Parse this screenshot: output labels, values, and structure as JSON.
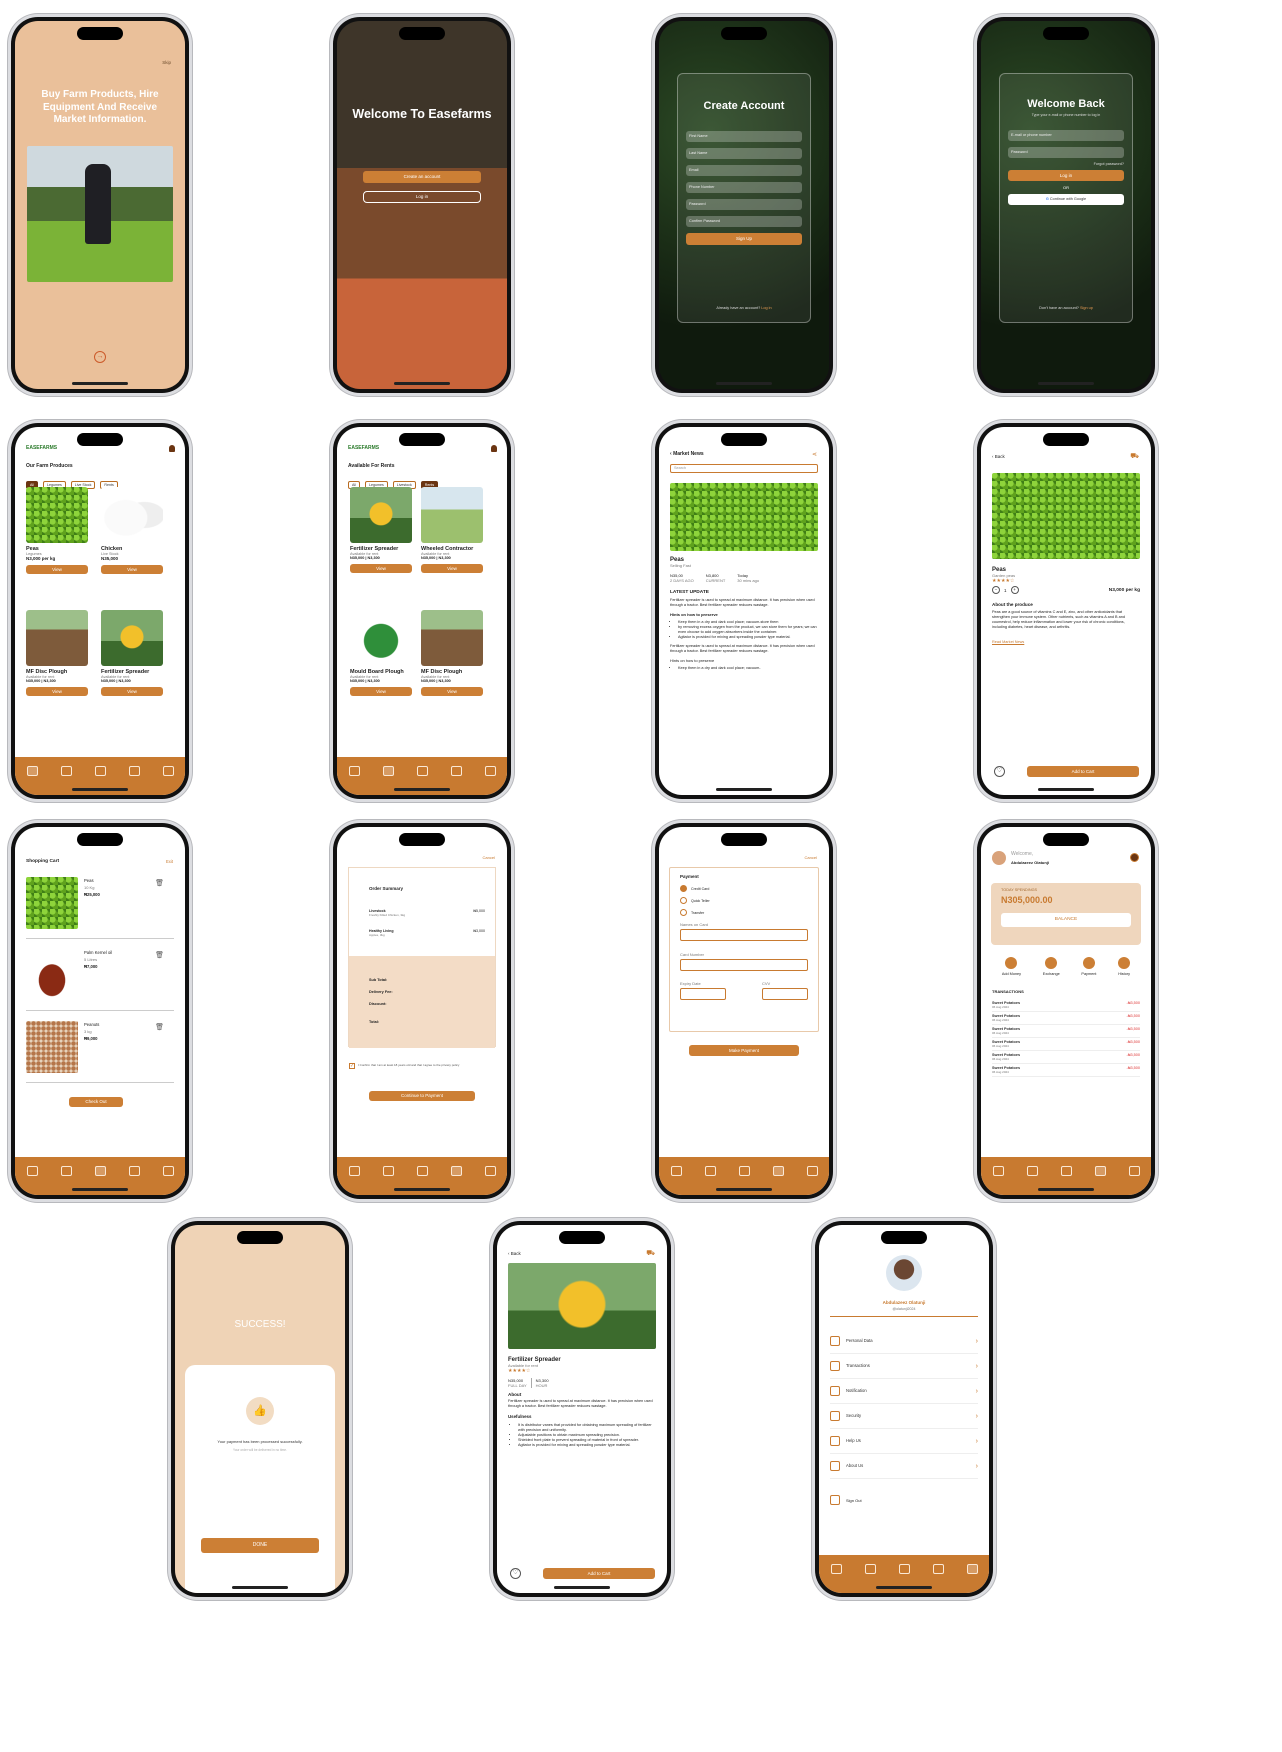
{
  "onboarding": {
    "skip": "Skip",
    "headline": "Buy Farm Products, Hire Equipment And Receive Market Information."
  },
  "welcome": {
    "title": "Welcome To Easefarms",
    "create": "Create an account",
    "login": "Log in"
  },
  "create_account": {
    "title": "Create Account",
    "fields": [
      "First Name",
      "Last Name",
      "Email",
      "Phone Number",
      "Password",
      "Confirm Password"
    ],
    "signup": "Sign Up",
    "footer": "Already have an account?",
    "footer_link": "Log in"
  },
  "welcome_back": {
    "title": "Welcome Back",
    "subtitle": "Type your e-mail or phone number to log in",
    "email": "E-mail or phone number",
    "password": "Password",
    "forgot": "Forgot password?",
    "login": "Log in",
    "or": "OR",
    "google": "Continue with Google",
    "footer": "Don't have an account?",
    "footer_link": "Sign up"
  },
  "farm_produces": {
    "logo": "EASEFARMS",
    "title": "Our Farm Produces",
    "filters": [
      "All",
      "Legumes",
      "Live Stock",
      "Rents"
    ],
    "items": [
      {
        "name": "Peas",
        "category": "Legumes",
        "price": "N3,000 per kg"
      },
      {
        "name": "Chicken",
        "category": "Live Stock",
        "price": "N35,000"
      }
    ],
    "rents": [
      {
        "name": "MF Disc Plough",
        "status": "Available for rent",
        "day": "N35,000",
        "day_lbl": "FULL DAY",
        "hour": "N3,300",
        "hour_lbl": "HOUR"
      },
      {
        "name": "Fertilizer Spreader",
        "status": "Available for rent",
        "day": "N35,000",
        "day_lbl": "FULL DAY",
        "hour": "N3,300",
        "hour_lbl": "HOUR"
      }
    ],
    "view": "View"
  },
  "rents": {
    "logo": "EASEFARMS",
    "title": "Available For Rents",
    "filters": [
      "All",
      "Legumes",
      "Livestock",
      "Rents"
    ],
    "items": [
      {
        "name": "Fertilizer Spreader",
        "status": "Available for rent",
        "day": "N35,000",
        "hour": "N3,300"
      },
      {
        "name": "Wheeled Contractor",
        "status": "Available for rent",
        "day": "N35,000",
        "hour": "N3,300"
      },
      {
        "name": "Mould Board Plough",
        "status": "Available for rent",
        "day": "N35,000",
        "hour": "N3,300"
      },
      {
        "name": "MF Disc Plough",
        "status": "Available for rent",
        "day": "N35,000",
        "hour": "N3,300"
      }
    ],
    "day_lbl": "FULL DAY",
    "hour_lbl": "HOUR",
    "view": "View"
  },
  "market_news": {
    "title": "Market News",
    "search": "Search",
    "product": "Peas",
    "selling": "Selling Fast",
    "p1": "N35,00",
    "p1_lbl": "2 DAYS AGO",
    "p2": "N3,800",
    "p2_lbl": "CURRENT",
    "p3": "Today",
    "p3_lbl": "30 mins ago",
    "latest": "LATEST UPDATE",
    "para": "Fertilizer spreader is used to spread at maximum distance. It has precision when used through a tractor. Best fertilizer spreader reduces wastage.",
    "hints": "Hints on how to preserve",
    "bullets": [
      "Keep them in a dry and dark cool place; vacuum-store them",
      "by removing excess oxygen from the product, we can store them for years; we can even choose to add oxygen absorbers inside the container.",
      "Agitator is provided for mixing and spreading powder type material."
    ],
    "para2": "Fertilizer spreader is used to spread at maximum distance. It has precision when used through a tractor. Best fertilizer spreader reduces wastage.",
    "hints2": "Hints on how to preserve",
    "bullet_last": "Keep them in a dry and dark cool place; vacuum-"
  },
  "product": {
    "back": "Back",
    "name": "Peas",
    "sub": "Garden peas",
    "qty": "1",
    "price": "N3,000 per kg",
    "about": "About the produce",
    "desc": "Peas are a good source of vitamins C and E, zinc, and other antioxidants that strengthen your immune system. Other nutrients, such as vitamins A and B and coumestrol, help reduce inflammation and lower your risk of chronic conditions, including diabetes, heart disease, and arthritis.",
    "link": "Read Market News",
    "cart": "Add to Cart"
  },
  "cart": {
    "title": "Shopping Cart",
    "exit": "Exit",
    "items": [
      {
        "name": "Peas",
        "qty": "10 Kg",
        "price": "₦25,000"
      },
      {
        "name": "Palm Kernel oil",
        "qty": "5 Litres",
        "price": "₦7,000"
      },
      {
        "name": "Peanuts",
        "qty": "3 kg",
        "price": "₦9,000"
      }
    ],
    "checkout": "Check Out"
  },
  "order": {
    "cancel": "Cancel",
    "title": "Order Summary",
    "l1": "Livestock",
    "l1s": "Freshly Killed Chicken, 3kg",
    "l1p": "₦5,000",
    "l2": "Healthy Living",
    "l2s": "Apples, 3kg",
    "l2p": "₦3,000",
    "subtotal": "Sub Total:",
    "delivery": "Delivery Fee:",
    "discount": "Discount:",
    "total": "Total:",
    "agree": "I Confirm that I am at least 18 years old and that I agree to the privacy policy",
    "cont": "Continue to Payment"
  },
  "payment": {
    "cancel": "Cancel",
    "title": "Payment",
    "options": [
      "Credit Card",
      "Quick Teller",
      "Transfer"
    ],
    "name": "Names on Card",
    "number": "Card Number",
    "expiry": "Expiry Date",
    "cvv": "CVV",
    "make": "Make Payment"
  },
  "wallet": {
    "welcome": "Welcome,",
    "user": "Abdulazeez Olatunji",
    "spend_lbl": "TODAY SPENDINGS",
    "spend": "N305,000.00",
    "balance": "BALANCE",
    "actions": [
      "Add Money",
      "Exchange",
      "Payment",
      "History"
    ],
    "tx_title": "TRANSACTIONS",
    "tx_name": "Sweet Potatoes",
    "tx_date": "06 Aug 2024",
    "tx_amt": "-₦3,500"
  },
  "success": {
    "title": "SUCCESS!",
    "msg": "Your payment has been processed successfully.",
    "sub": "Your order will be delivered in no time.",
    "done": "DONE"
  },
  "equipment": {
    "back": "Back",
    "name": "Fertilizer Spreader",
    "status": "Available for rent",
    "day": "N35,000",
    "day_lbl": "FULL DAY",
    "hour": "N3,300",
    "hour_lbl": "HOUR",
    "about": "About",
    "desc": "Fertilizer spreader is used to spread at maximum distance. It has precision when used through a tractor. Best fertilizer spreader reduces wastage.",
    "use": "Usefulness",
    "bullets": [
      "It is distributor vanes that provided for obtaining maximum spreading of fertilizer with precision and uniformity.",
      "Adjustable positions to obtain maximum spreading precision.",
      "Shielded front plate to prevent spreading of material in front of spreader.",
      "Agitator is provided for mixing and spreading powder type material."
    ],
    "cart": "Add to Cart"
  },
  "profile": {
    "name": "Abdulazeez Olatunji",
    "handle": "@olatunji2024",
    "items": [
      "Personal Data",
      "Transactions",
      "Notification",
      "Security",
      "Help Us",
      "About Us"
    ],
    "signout": "Sign Out"
  },
  "colors": {
    "accent": "#cc7f35",
    "peach": "#efd6bd",
    "brown": "#6b3512"
  }
}
